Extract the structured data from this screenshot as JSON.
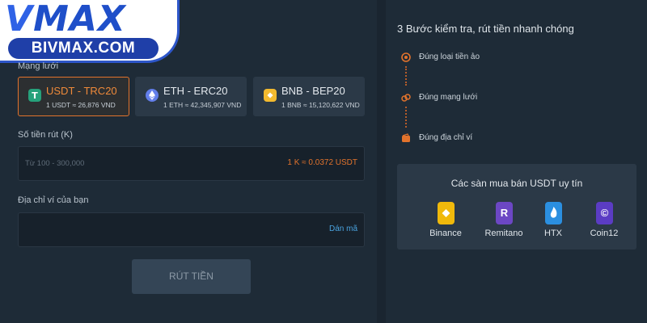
{
  "logo": {
    "brand_v": "V",
    "brand_rest": "MAX",
    "domain": "BIVMAX.COM"
  },
  "withdraw_form": {
    "network_label": "Mạng lưới",
    "networks": [
      {
        "name": "USDT - TRC20",
        "rate": "1 USDT ≈ 26,876 VND",
        "icon": "tether-icon",
        "color": "#26a17b",
        "active": true
      },
      {
        "name": "ETH - ERC20",
        "rate": "1 ETH ≈ 42,345,907 VND",
        "icon": "ethereum-icon",
        "color": "#627eea",
        "active": false
      },
      {
        "name": "BNB - BEP20",
        "rate": "1 BNB ≈ 15,120,622 VND",
        "icon": "bnb-icon",
        "color": "#f3ba2f",
        "active": false
      }
    ],
    "amount_label": "Số tiền rút (K)",
    "amount_placeholder": "Từ 100 - 300,000",
    "conversion": "1 K ≈ 0.0372 USDT",
    "wallet_label": "Địa chỉ ví của bạn",
    "paste_label": "Dán mã",
    "submit_label": "RÚT TIỀN"
  },
  "steps": {
    "title": "3 Bước kiểm tra, rút tiền nhanh chóng",
    "items": [
      {
        "label": "Đúng loại tiền ảo",
        "icon": "coin-icon"
      },
      {
        "label": "Đúng mạng lưới",
        "icon": "network-icon"
      },
      {
        "label": "Đúng địa chỉ ví",
        "icon": "wallet-icon"
      }
    ]
  },
  "exchanges": {
    "title": "Các sàn mua bán USDT uy tín",
    "items": [
      {
        "name": "Binance",
        "icon": "binance-icon",
        "color": "#f0b90b",
        "glyph": "◆"
      },
      {
        "name": "Remitano",
        "icon": "remitano-icon",
        "color": "#6c47c4",
        "glyph": "R"
      },
      {
        "name": "HTX",
        "icon": "htx-icon",
        "color": "#2b8fe0",
        "glyph": "♦"
      },
      {
        "name": "Coin12",
        "icon": "coin12-icon",
        "color": "#5b3cc4",
        "glyph": "©"
      }
    ]
  },
  "colors": {
    "accent": "#e2732c",
    "panel": "#1e2b37",
    "card": "#2b3947",
    "link": "#4aa3df"
  }
}
